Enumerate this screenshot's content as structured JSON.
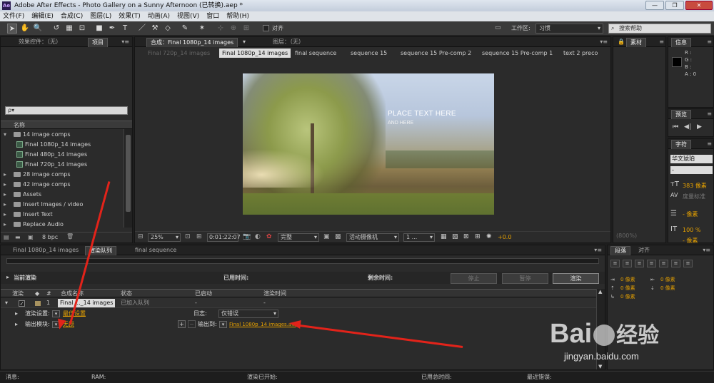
{
  "window": {
    "title": "Adobe After Effects - Photo Gallery on a Sunny Afternoon (已转换).aep *",
    "app_badge": "Ae",
    "controls": [
      "—",
      "❐",
      "✕"
    ]
  },
  "menu": [
    "文件(F)",
    "编辑(E)",
    "合成(C)",
    "图层(L)",
    "效果(T)",
    "动画(A)",
    "视图(V)",
    "窗口",
    "帮助(H)"
  ],
  "toolbar": {
    "align_label": "对齐",
    "workspace_label": "工作区:",
    "workspace_value": "习惯",
    "search_placeholder": "搜索帮助"
  },
  "project_panel": {
    "tabs": [
      "效果控件：（无）",
      "项目"
    ],
    "search_placeholder": "ρ▾",
    "column_name": "名称",
    "items": [
      {
        "name": "14 image comps",
        "type": "folder",
        "open": true
      },
      {
        "name": "Final 1080p_14 images",
        "type": "comp"
      },
      {
        "name": "Final 480p_14 images",
        "type": "comp"
      },
      {
        "name": "Final 720p_14 images",
        "type": "comp"
      },
      {
        "name": "28 image comps",
        "type": "folder"
      },
      {
        "name": "42 image comps",
        "type": "folder"
      },
      {
        "name": "Assets",
        "type": "folder"
      },
      {
        "name": "Insert Images / video",
        "type": "folder"
      },
      {
        "name": "Insert Text",
        "type": "folder"
      },
      {
        "name": "Replace Audio",
        "type": "folder"
      },
      {
        "name": "Solids",
        "type": "folder"
      }
    ],
    "bpc": "8 bpc"
  },
  "comp_panel": {
    "tab_comp": "合成：Final 1080p_14 images",
    "tab_layer": "图层：（无）",
    "breadcrumbs": [
      "Final 720p_14 images",
      "Final 1080p_14 images",
      "final sequence",
      "sequence 15",
      "sequence 15 Pre-comp 2",
      "sequence 15 Pre-comp 1",
      "text 2 preco"
    ],
    "preview_text_main": "PLACE TEXT HERE",
    "preview_text_sub": "AND HERE",
    "zoom": "25%",
    "timecode": "0:01:22:07",
    "resolution": "完整",
    "camera": "活动摄像机",
    "views": "1 ...",
    "exposure": "+0.0"
  },
  "right_panels": {
    "material_tab": "素材",
    "info_tab": "信息",
    "info_rgba": [
      "R :",
      "G :",
      "B :",
      "A : 0"
    ],
    "preview_tab": "预览",
    "char_tab": "字符",
    "font_name": "华文琥珀",
    "font_style": "-",
    "font_size": "383 像素",
    "kerning": "度量标准",
    "leading_unit": "- 像素",
    "scale": "100 %",
    "baseline_unit": "- 像素",
    "material_zoom": "(800%)"
  },
  "paragraph_panel": {
    "tabs": [
      "段落",
      "对齐"
    ],
    "indent_values": [
      "0 像素",
      "0 像素",
      "0 像素",
      "0 像素",
      "0 像素"
    ]
  },
  "render_queue": {
    "tabs": [
      "Final 1080p_14 images",
      "渲染队列",
      "final sequence"
    ],
    "current_render": "当前渲染",
    "elapsed_label": "已用时间:",
    "remaining_label": "剩余时间:",
    "stop_btn": "停止",
    "pause_btn": "暂停",
    "render_btn": "渲染",
    "columns": [
      "渲染",
      "#",
      "合成名称",
      "状态",
      "已启动",
      "渲染时间"
    ],
    "row": {
      "index": "1",
      "comp_name": "Final ..._14 images",
      "status": "已加入队列",
      "started": "-",
      "render_time": "-"
    },
    "render_settings_label": "渲染设置:",
    "render_settings_value": "最佳设置",
    "log_label": "日志:",
    "log_value": "仅错误",
    "output_module_label": "输出模块:",
    "output_module_value": "无损",
    "output_to_label": "输出到:",
    "output_to_value": "Final 1080p_14 images.avi"
  },
  "status_bar": {
    "message": "消息:",
    "ram": "RAM:",
    "render_started": "渲染已开始:",
    "total_time": "已用总时间:",
    "last_error": "最近错误:"
  },
  "watermark": {
    "brand": "Bai",
    "brand2": "经验",
    "url": "jingyan.baidu.com"
  },
  "colors": {
    "accent_orange": "#e6a100",
    "arrow_red": "#e2231a",
    "panel_bg": "#2b2b2b"
  }
}
